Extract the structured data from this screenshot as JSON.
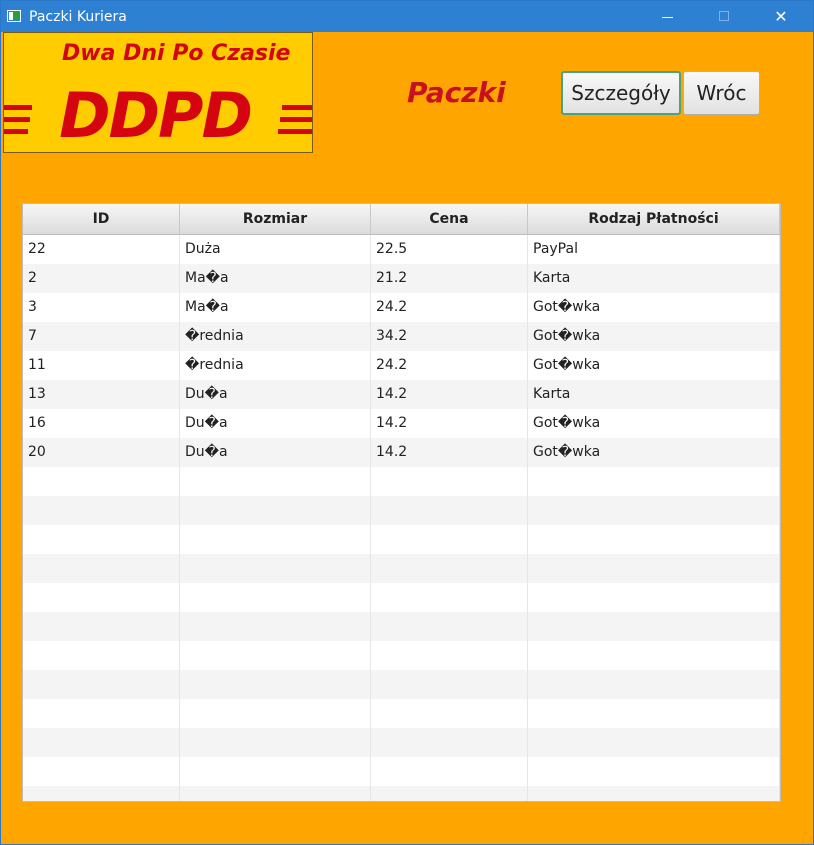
{
  "window": {
    "title": "Paczki Kuriera",
    "close_symbol": "✕"
  },
  "logo": {
    "tagline": "Dwa Dni Po Czasie",
    "wordmark": "DDPD"
  },
  "header": {
    "title": "Paczki"
  },
  "buttons": {
    "details": "Szczegóły",
    "back": "Wróc"
  },
  "table": {
    "columns": [
      "ID",
      "Rozmiar",
      "Cena",
      "Rodzaj Płatności"
    ],
    "rows": [
      [
        "22",
        "Duża",
        "22.5",
        "PayPal"
      ],
      [
        "2",
        "Ma�a",
        "21.2",
        "Karta"
      ],
      [
        "3",
        "Ma�a",
        "24.2",
        "Got�wka"
      ],
      [
        "7",
        "�rednia",
        "34.2",
        "Got�wka"
      ],
      [
        "11",
        "�rednia",
        "24.2",
        "Got�wka"
      ],
      [
        "13",
        "Du�a",
        "14.2",
        "Karta"
      ],
      [
        "16",
        "Du�a",
        "14.2",
        "Got�wka"
      ],
      [
        "20",
        "Du�a",
        "14.2",
        "Got�wka"
      ]
    ]
  },
  "colors": {
    "background": "#ffa500",
    "titlebar": "#2d80d2",
    "logo_yellow": "#ffcc00",
    "logo_red": "#d40511",
    "heading_red": "#c8101e"
  },
  "icons": {
    "app": "app-window-icon",
    "minimize": "minimize-icon",
    "maximize": "maximize-icon",
    "close": "close-icon"
  }
}
